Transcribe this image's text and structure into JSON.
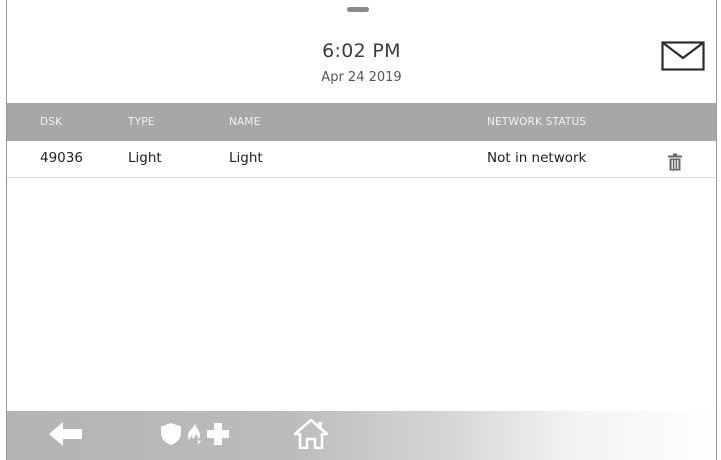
{
  "header": {
    "time": "6:02 PM",
    "date": "Apr 24 2019"
  },
  "icons": {
    "handle": "pull-down-handle",
    "messages": "envelope-icon",
    "delete": "trash-icon",
    "back": "back-arrow-icon",
    "emergency": [
      "shield-icon",
      "fire-icon",
      "medical-cross-icon"
    ],
    "home": "home-icon"
  },
  "table": {
    "columns": {
      "dsk": "DSK",
      "type": "TYPE",
      "name": "NAME",
      "status": "NETWORK STATUS"
    },
    "rows": [
      {
        "dsk": "49036",
        "type": "Light",
        "name": "Light",
        "status": "Not in network"
      }
    ]
  },
  "colors": {
    "header_bar": "#a7a7a7",
    "footer_start": "#b3b3b3",
    "footer_end": "#ffffff"
  }
}
